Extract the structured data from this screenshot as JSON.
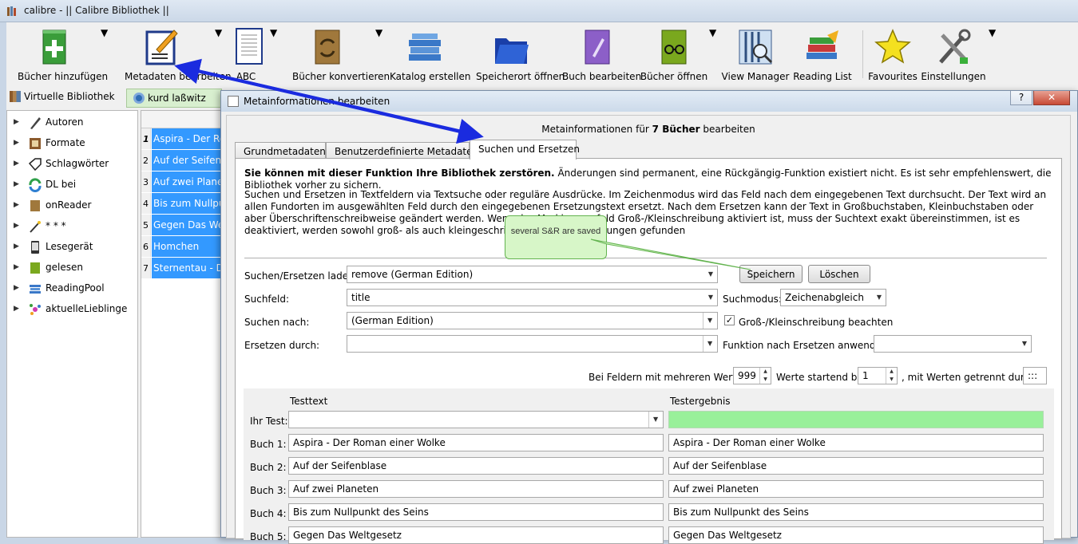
{
  "window": {
    "title": "calibre - || Calibre Bibliothek ||"
  },
  "toolbar": {
    "add_books": "Bücher hinzufügen",
    "edit_metadata": "Metadaten bearbeiten",
    "abc": "ABC",
    "convert": "Bücher konvertieren",
    "catalog": "Katalog erstellen",
    "save_location": "Speicherort öffnen",
    "edit_book": "Buch bearbeiten",
    "open_books": "Bücher öffnen",
    "view_manager": "View Manager",
    "reading_list": "Reading List",
    "favourites": "Favourites",
    "settings": "Einstellungen"
  },
  "virtual_library": {
    "label": "Virtuelle Bibliothek",
    "search": "kurd laßwitz"
  },
  "sidebar": {
    "items": [
      "Autoren",
      "Formate",
      "Schlagwörter",
      "DL bei",
      "onReader",
      "* * *",
      "Lesegerät",
      "gelesen",
      "ReadingPool",
      "aktuelleLieblinge"
    ]
  },
  "booklist": {
    "rows": [
      {
        "num": "1",
        "title": "Aspira - Der Roman einer Wolke"
      },
      {
        "num": "2",
        "title": "Auf der Seifenblase"
      },
      {
        "num": "3",
        "title": "Auf zwei Planeten"
      },
      {
        "num": "4",
        "title": "Bis zum Nullpunkt des Seins"
      },
      {
        "num": "5",
        "title": "Gegen Das Weltgesetz"
      },
      {
        "num": "6",
        "title": "Homchen"
      },
      {
        "num": "7",
        "title": "Sternentau - Die Pflanze vom Neptunsmond"
      }
    ]
  },
  "dialog": {
    "title": "Metainformationen bearbeiten",
    "help": "?",
    "close": "✕",
    "header_pre": "Metainformationen für ",
    "header_bold": "7 Bücher",
    "header_post": " bearbeiten",
    "tabs": [
      "Grundmetadaten",
      "Benutzerdefinierte Metadaten",
      "Suchen und Ersetzen"
    ],
    "warning_bold": "Sie können mit dieser Funktion Ihre Bibliothek zerstören.",
    "warning_rest": " Änderungen sind permanent, eine Rückgängig-Funktion existiert nicht. Es ist sehr empfehlenswert, die Bibliothek vorher zu sichern.",
    "description": "Suchen und Ersetzen in Textfeldern via Textsuche oder reguläre Ausdrücke. Im Zeichenmodus wird das Feld nach dem eingegebenen Text durchsucht. Der Text wird an allen Fundorten im ausgewählten Feld durch den eingegebenen Ersetzungstext ersetzt. Nach dem Ersetzen kann der Text in Großbuchstaben, Kleinbuchstaben oder aber Überschriftenschreibweise geändert werden. Wenn das Markierungsfeld Groß-/Kleinschreibung aktiviert ist, muss der Suchtext exakt übereinstimmen, ist es deaktiviert, werden sowohl groß- als auch kleingeschriebene Übereinstimmungen gefunden",
    "load_label": "Suchen/Ersetzen laden:",
    "load_value": "remove  (German Edition)",
    "save_btn": "Speichern",
    "delete_btn": "Löschen",
    "field_label": "Suchfeld:",
    "field_value": "title",
    "mode_label": "Suchmodus:",
    "mode_value": "Zeichenabgleich",
    "search_label": "Suchen nach:",
    "search_value": "(German Edition)",
    "case_label": "Groß-/Kleinschreibung beachten",
    "case_checked": "✓",
    "replace_label": "Ersetzen durch:",
    "replace_value": "",
    "func_label": "Funktion nach Ersetzen anwenden:",
    "multi_label": "Bei Feldern mit mehreren Werten",
    "multi_value": "999",
    "start_label": "Werte startend bei",
    "start_value": "1",
    "sep_label": ", mit Werten getrennt durch",
    "sep_value": ":::",
    "test_header": "Testtext",
    "result_header": "Testergebnis",
    "your_test": "Ihr Test:",
    "books": [
      {
        "label": "Buch 1:",
        "text": "Aspira - Der Roman einer Wolke",
        "result": "Aspira - Der Roman einer Wolke"
      },
      {
        "label": "Buch 2:",
        "text": "Auf der Seifenblase",
        "result": "Auf der Seifenblase"
      },
      {
        "label": "Buch 3:",
        "text": "Auf zwei Planeten",
        "result": "Auf zwei Planeten"
      },
      {
        "label": "Buch 4:",
        "text": "Bis zum Nullpunkt des Seins",
        "result": "Bis zum Nullpunkt des Seins"
      },
      {
        "label": "Buch 5:",
        "text": "Gegen Das Weltgesetz",
        "result": "Gegen Das Weltgesetz"
      }
    ]
  },
  "callout": {
    "text": "several S&R are saved"
  },
  "colors": {
    "selection": "#3399ff",
    "arrow": "#1a2bdf",
    "callout_fill": "#d7f6c8",
    "test_result": "#99f09a"
  }
}
